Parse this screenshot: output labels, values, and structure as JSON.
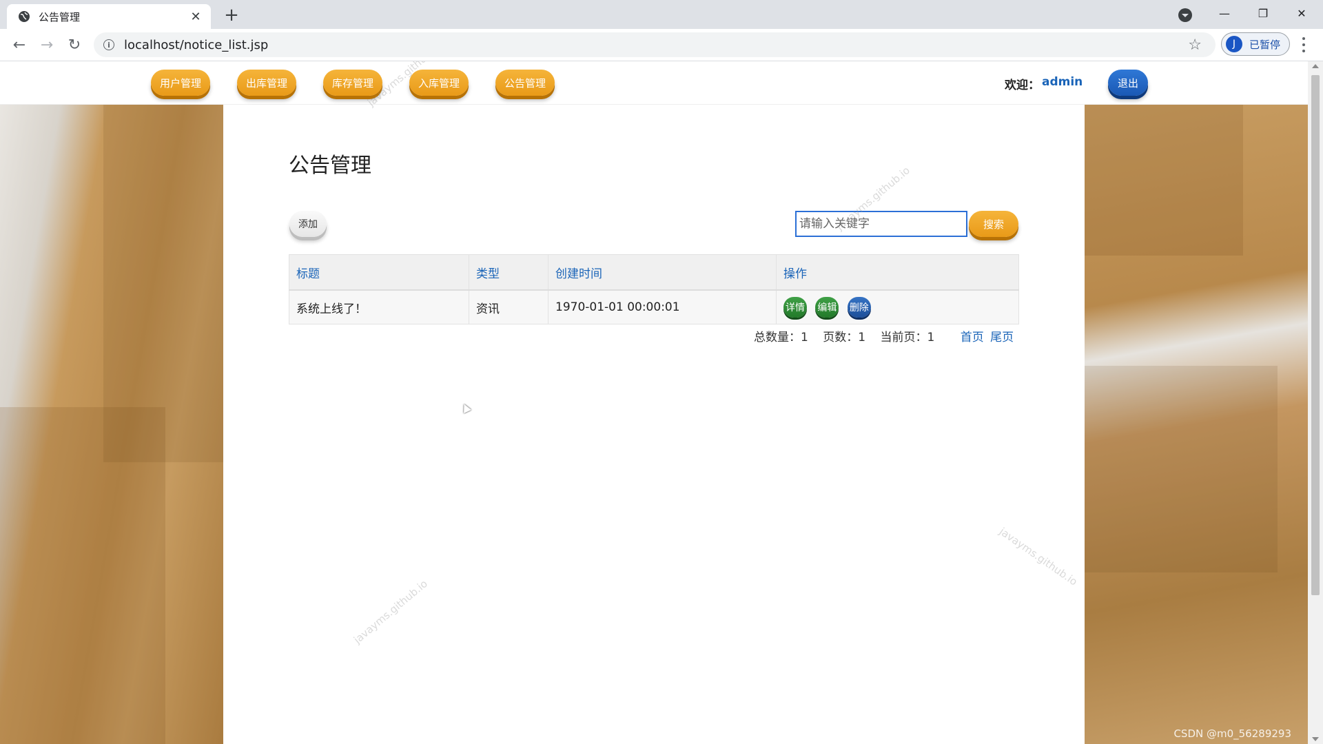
{
  "browser": {
    "tab_title": "公告管理",
    "new_tab_label": "+",
    "url": "localhost/notice_list.jsp",
    "profile_initial": "J",
    "profile_label": "已暂停"
  },
  "nav": {
    "items": [
      "用户管理",
      "出库管理",
      "库存管理",
      "入库管理",
      "公告管理"
    ],
    "welcome_label": "欢迎：",
    "username": "admin",
    "logout_label": "退出"
  },
  "page": {
    "title": "公告管理",
    "add_label": "添加",
    "search_placeholder": "请输入关键字",
    "search_label": "搜索"
  },
  "table": {
    "headers": [
      "标题",
      "类型",
      "创建时间",
      "操作"
    ],
    "rows": [
      {
        "title": "系统上线了！",
        "type": "资讯",
        "created": "1970-01-01 00:00:01",
        "actions": [
          "详情",
          "编辑",
          "删除"
        ]
      }
    ]
  },
  "pager": {
    "total_label": "总数量：",
    "total": "1",
    "pages_label": "页数：",
    "pages": "1",
    "current_label": "当前页：",
    "current": "1",
    "first_label": "首页",
    "last_label": "尾页"
  },
  "watermarks": [
    "javayms.github.io",
    "javayms.github.io",
    "javayms.github.io",
    "javayms.github.io"
  ],
  "footer_credit": "CSDN @m0_56289293",
  "colors": {
    "accent_orange": "#e99a18",
    "accent_blue": "#1a58b4",
    "link_blue": "#1a64b8",
    "action_green": "#237a2a"
  }
}
